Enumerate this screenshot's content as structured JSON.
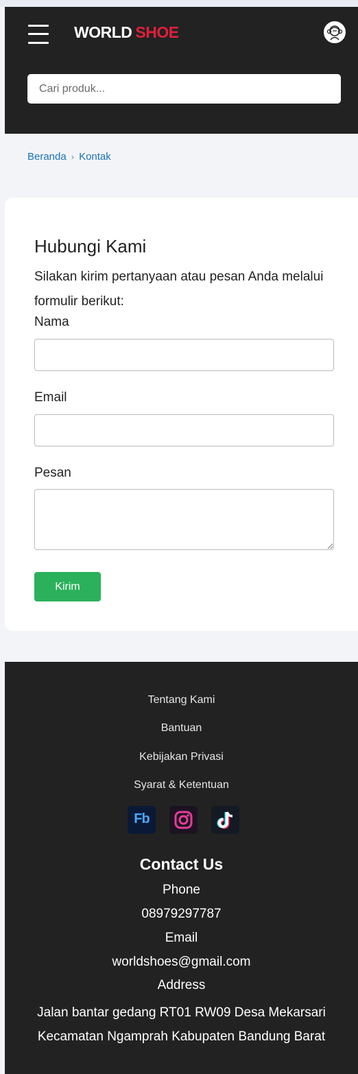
{
  "header": {
    "logo_word1": "WORLD",
    "logo_word2": "SHOE",
    "search_placeholder": "Cari produk..."
  },
  "breadcrumb": {
    "home": "Beranda",
    "separator": "›",
    "current": "Kontak"
  },
  "contact_form": {
    "title": "Hubungi Kami",
    "intro": "Silakan kirim pertanyaan atau pesan Anda melalui formulir berikut:",
    "name_label": "Nama",
    "name_value": "",
    "email_label": "Email",
    "email_value": "",
    "message_label": "Pesan",
    "message_value": "",
    "submit_label": "Kirim"
  },
  "footer": {
    "links": [
      "Tentang Kami",
      "Bantuan",
      "Kebijakan Privasi",
      "Syarat & Ketentuan"
    ],
    "social": [
      {
        "label": "Fb",
        "icon": "facebook-icon"
      },
      {
        "icon": "instagram-icon"
      },
      {
        "icon": "tiktok-icon"
      }
    ],
    "contact_title": "Contact Us",
    "phone_label": "Phone",
    "phone": "08979297787",
    "email_label": "Email",
    "email": "worldshoes@gmail.com",
    "address_label": "Address",
    "address": "Jalan bantar gedang RT01 RW09 Desa Mekarsari Kecamatan Ngamprah Kabupaten Bandung Barat"
  },
  "colors": {
    "header_bg": "#222222",
    "logo_accent": "#e0203a",
    "link": "#1a73b8",
    "submit": "#2bb15b",
    "page_bg": "#f3f4f8"
  }
}
